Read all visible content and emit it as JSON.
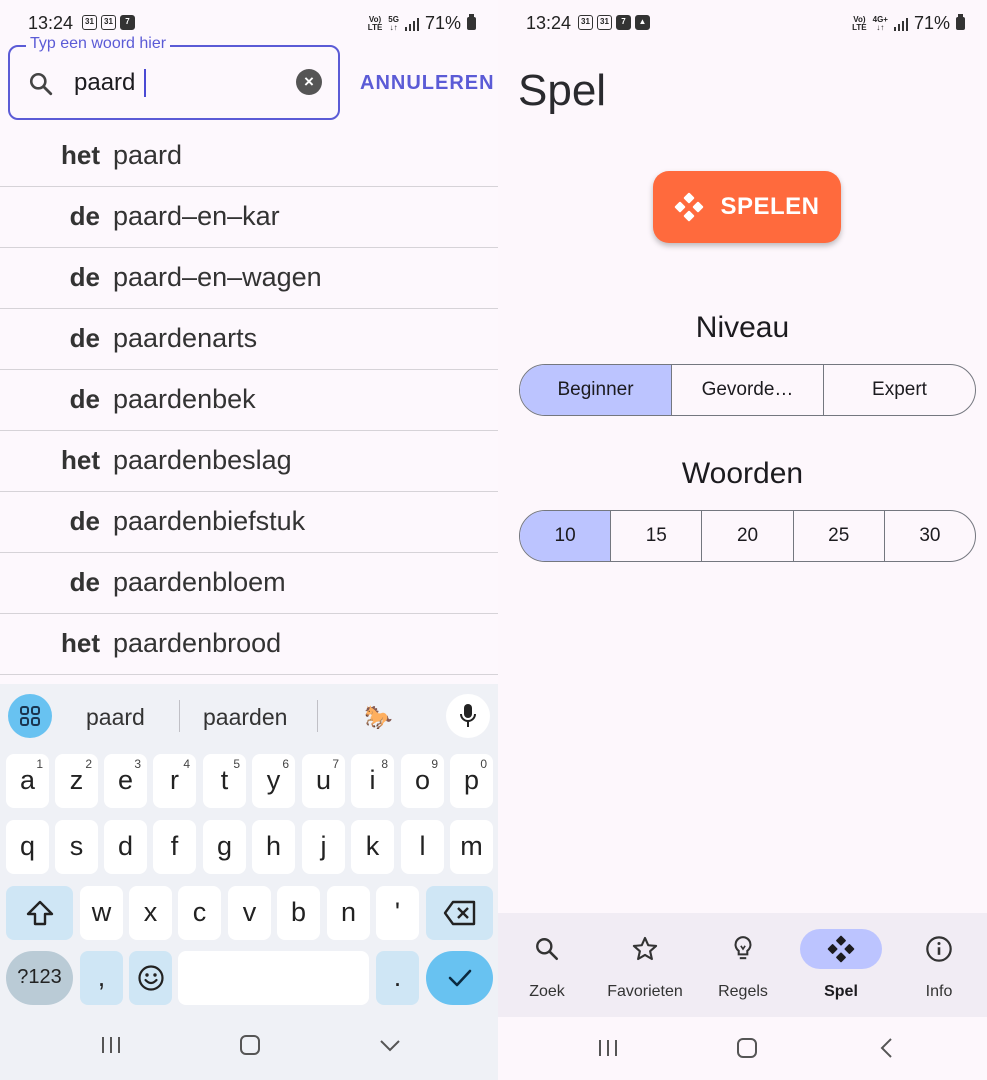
{
  "left_screen": {
    "status": {
      "time": "13:24",
      "network": "Vo) 5G LTE",
      "battery": "71%"
    },
    "search": {
      "label": "Typ een woord hier",
      "value": "paard",
      "cancel": "ANNULEREN"
    },
    "results": [
      {
        "article": "het",
        "word": "paard"
      },
      {
        "article": "de",
        "word": "paard–en–kar"
      },
      {
        "article": "de",
        "word": "paard–en–wagen"
      },
      {
        "article": "de",
        "word": "paardenarts"
      },
      {
        "article": "de",
        "word": "paardenbek"
      },
      {
        "article": "het",
        "word": "paardenbeslag"
      },
      {
        "article": "de",
        "word": "paardenbiefstuk"
      },
      {
        "article": "de",
        "word": "paardenbloem"
      },
      {
        "article": "het",
        "word": "paardenbrood"
      }
    ],
    "keyboard": {
      "suggestions": [
        "paard",
        "paarden",
        "🐎"
      ],
      "row1": [
        {
          "k": "a",
          "n": "1"
        },
        {
          "k": "z",
          "n": "2"
        },
        {
          "k": "e",
          "n": "3"
        },
        {
          "k": "r",
          "n": "4"
        },
        {
          "k": "t",
          "n": "5"
        },
        {
          "k": "y",
          "n": "6"
        },
        {
          "k": "u",
          "n": "7"
        },
        {
          "k": "i",
          "n": "8"
        },
        {
          "k": "o",
          "n": "9"
        },
        {
          "k": "p",
          "n": "0"
        }
      ],
      "row2": [
        "q",
        "s",
        "d",
        "f",
        "g",
        "h",
        "j",
        "k",
        "l",
        "m"
      ],
      "row3": [
        "w",
        "x",
        "c",
        "v",
        "b",
        "n",
        "'"
      ],
      "symbols": "?123",
      "comma": ",",
      "period": "."
    }
  },
  "right_screen": {
    "status": {
      "time": "13:24",
      "network": "Vo) 4G+ LTE",
      "battery": "71%"
    },
    "title": "Spel",
    "play_button": "SPELEN",
    "level": {
      "title": "Niveau",
      "options": [
        "Beginner",
        "Gevorde…",
        "Expert"
      ],
      "selected": 0
    },
    "words": {
      "title": "Woorden",
      "options": [
        "10",
        "15",
        "20",
        "25",
        "30"
      ],
      "selected": 0
    },
    "bottom_nav": [
      {
        "label": "Zoek",
        "icon": "search-icon"
      },
      {
        "label": "Favorieten",
        "icon": "star-icon"
      },
      {
        "label": "Regels",
        "icon": "lightbulb-icon"
      },
      {
        "label": "Spel",
        "icon": "gamepad-icon",
        "active": true
      },
      {
        "label": "Info",
        "icon": "info-icon"
      }
    ],
    "colors": {
      "accent": "#5b5bd6",
      "play": "#ff6a3d",
      "selected": "#bcc4ff"
    }
  }
}
